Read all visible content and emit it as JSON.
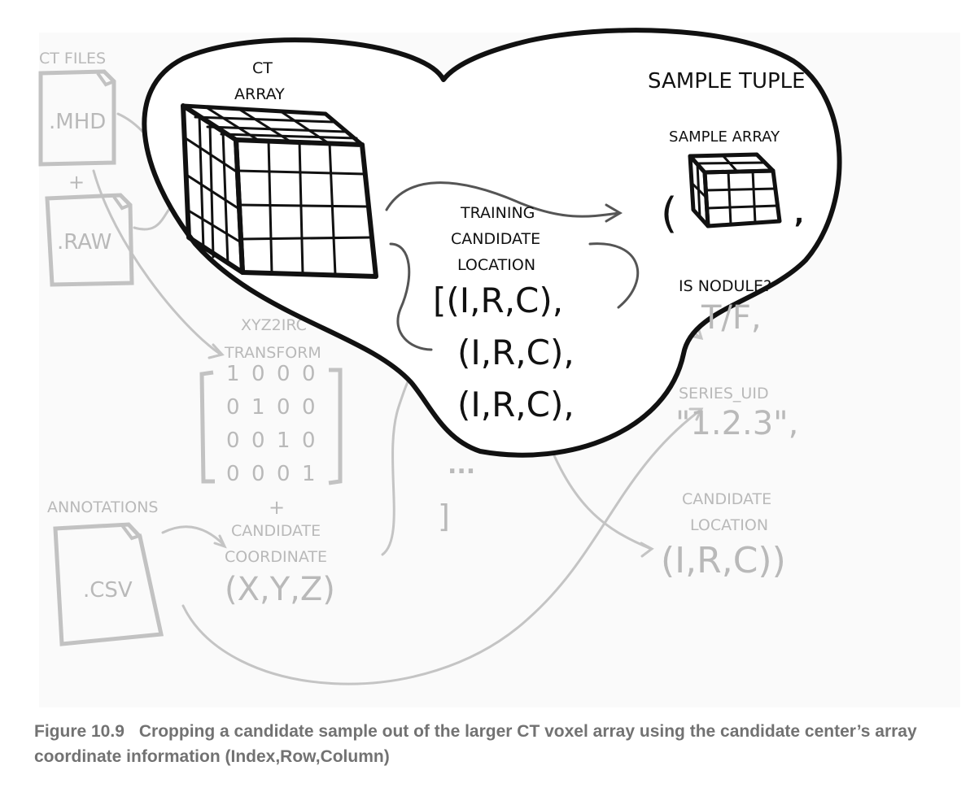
{
  "diagram": {
    "ct_files": {
      "title": "CT FILES",
      "mhd": ".MHD",
      "plus": "+",
      "raw": ".RAW"
    },
    "ct_array": {
      "line1": "CT",
      "line2": "ARRAY"
    },
    "sample_tuple": {
      "title": "SAMPLE TUPLE",
      "sample_array": "SAMPLE ARRAY",
      "open_paren": "(",
      "comma": ",",
      "is_nodule": "IS NODULE?",
      "tf": "T/F,",
      "series_uid": "SERIES_UID",
      "uid_value": "\"1.2.3\",",
      "candidate_location_line1": "CANDIDATE",
      "candidate_location_line2": "LOCATION",
      "candidate_location_value": "(I,R,C))"
    },
    "training_candidates": {
      "line1": "TRAINING",
      "line2": "CANDIDATE",
      "line3": "LOCATION",
      "row1": "[(I,R,C),",
      "row2": "(I,R,C),",
      "row3": "(I,R,C),",
      "ellipsis": "...",
      "close": "]"
    },
    "transform": {
      "line1": "XYZ2IRC",
      "line2": "TRANSFORM",
      "plus_top": "+",
      "plus_bottom": "+",
      "matrix": [
        [
          "1",
          "0",
          "0",
          "0"
        ],
        [
          "0",
          "1",
          "0",
          "0"
        ],
        [
          "0",
          "0",
          "1",
          "0"
        ],
        [
          "0",
          "0",
          "0",
          "1"
        ]
      ]
    },
    "annotations": {
      "title": "ANNOTATIONS",
      "csv": ".CSV",
      "coord_line1": "CANDIDATE",
      "coord_line2": "COORDINATE",
      "coord_value": "(X,Y,Z)"
    }
  },
  "caption": {
    "number": "Figure 10.9",
    "text": "Cropping a candidate sample out of the larger CT voxel array using the candidate center’s array coordinate information (Index,Row,Column)"
  },
  "colors": {
    "ink": "#111111",
    "faded": "#b9b9b9",
    "caption": "#727272"
  }
}
